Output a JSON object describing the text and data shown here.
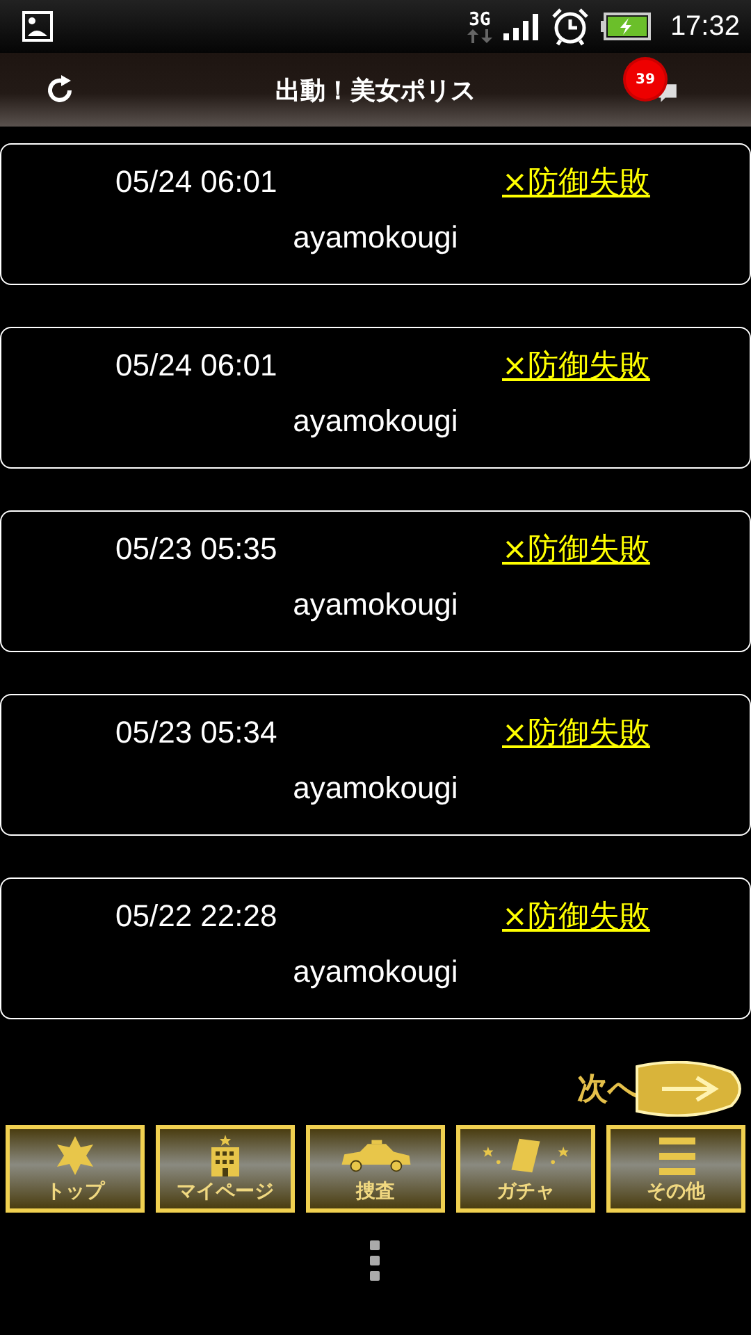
{
  "status_bar": {
    "network": "3G",
    "time": "17:32"
  },
  "header": {
    "title": "出動！美女ポリス",
    "badge": "39"
  },
  "records": [
    {
      "date": "05/24 06:01",
      "result": "×防御失敗",
      "name": "ayamokougi"
    },
    {
      "date": "05/24 06:01",
      "result": "×防御失敗",
      "name": "ayamokougi"
    },
    {
      "date": "05/23 05:35",
      "result": "×防御失敗",
      "name": "ayamokougi"
    },
    {
      "date": "05/23 05:34",
      "result": "×防御失敗",
      "name": "ayamokougi"
    },
    {
      "date": "05/22 22:28",
      "result": "×防御失敗",
      "name": "ayamokougi"
    }
  ],
  "next_button": "次へ",
  "nav": [
    {
      "label": "トップ"
    },
    {
      "label": "マイページ"
    },
    {
      "label": "捜査"
    },
    {
      "label": "ガチャ"
    },
    {
      "label": "その他"
    }
  ]
}
